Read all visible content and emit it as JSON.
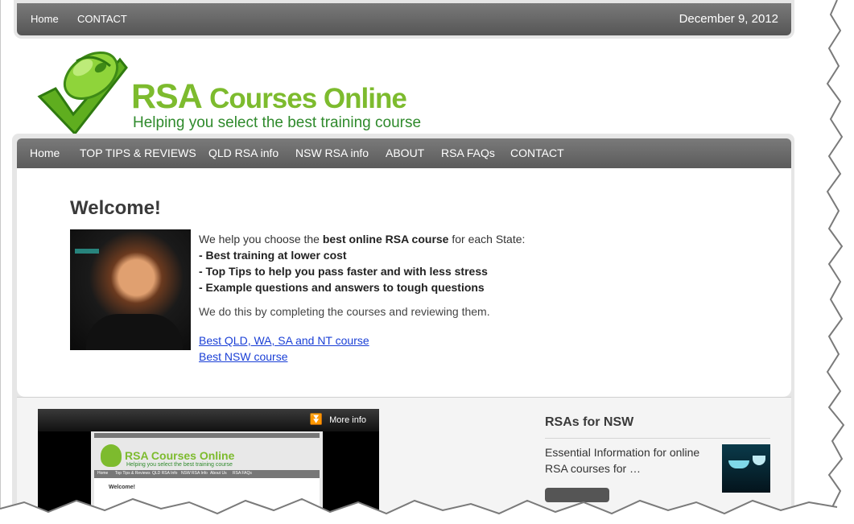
{
  "topbar": {
    "links": [
      "Home",
      "CONTACT"
    ],
    "date": "December 9, 2012"
  },
  "logo": {
    "title_main": "RSA",
    "title_rest": "Courses Online",
    "tagline": "Helping you select the best training course"
  },
  "nav": {
    "items": [
      "Home",
      "TOP TIPS & REVIEWS",
      "QLD RSA info",
      "NSW RSA info",
      "ABOUT",
      "RSA FAQs",
      "CONTACT"
    ]
  },
  "content": {
    "heading": "Welcome!",
    "intro_prefix": "We help you choose the ",
    "intro_bold": "best online RSA course",
    "intro_suffix": " for each State:",
    "bullets": [
      "- Best training at lower cost",
      "- Top Tips to help you pass faster and with less stress",
      "- Example questions and answers to tough questions"
    ],
    "note": "We do this by completing the courses and reviewing them.",
    "links": [
      "Best QLD, WA, SA and NT course",
      "Best NSW course"
    ]
  },
  "video": {
    "more_info": "More info",
    "thumb_title": "RSA Courses Online",
    "thumb_tagline": "Helping you select the best training course",
    "thumb_nav": [
      "Home",
      "Top Tips & Reviews",
      "QLD RSA Info",
      "NSW RSA Info",
      "About Us",
      "RSA FAQs"
    ],
    "thumb_heading": "Welcome!"
  },
  "sidebar": {
    "title": "RSAs for NSW",
    "text": "Essential Information for online RSA courses for …"
  },
  "colors": {
    "brand_green": "#7dbb2e",
    "tagline_green": "#2f8a2c",
    "nav_gray": "#666666",
    "link_blue": "#1a3fd6"
  }
}
